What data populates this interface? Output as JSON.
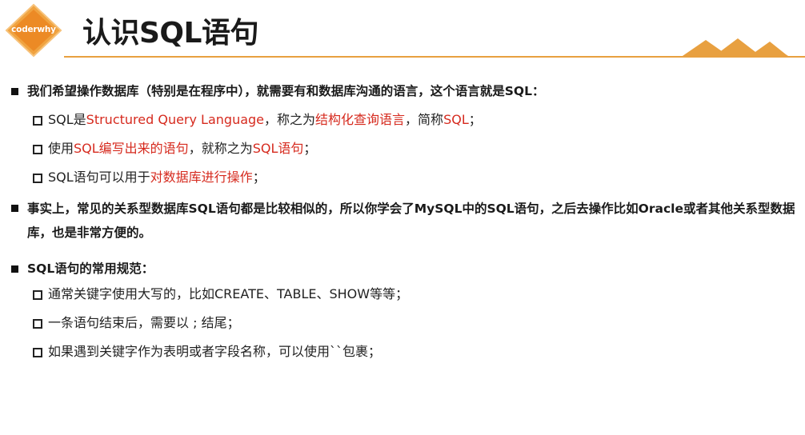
{
  "logo": {
    "text": "coderwhy",
    "bg_color": "#f0a340",
    "inner_color": "#ec8a25"
  },
  "title": "认识SQL语句",
  "accent_color": "#e8a040",
  "highlight_color": "#d62a1e",
  "sections": [
    {
      "text": "我们希望操作数据库（特别是在程序中），就需要有和数据库沟通的语言，这个语言就是SQL：",
      "items": [
        [
          {
            "t": "SQL是"
          },
          {
            "t": "Structured Query Language",
            "red": true
          },
          {
            "t": "，称之为"
          },
          {
            "t": "结构化查询语言",
            "red": true
          },
          {
            "t": "，简称"
          },
          {
            "t": "SQL",
            "red": true
          },
          {
            "t": "；"
          }
        ],
        [
          {
            "t": "使用"
          },
          {
            "t": "SQL编写出来的语句",
            "red": true
          },
          {
            "t": "，就称之为"
          },
          {
            "t": "SQL语句",
            "red": true
          },
          {
            "t": "；"
          }
        ],
        [
          {
            "t": "SQL语句可以用于"
          },
          {
            "t": "对数据库进行操作",
            "red": true
          },
          {
            "t": "；"
          }
        ]
      ]
    },
    {
      "text": "事实上，常见的关系型数据库SQL语句都是比较相似的，所以你学会了MySQL中的SQL语句，之后去操作比如Oracle或者其他关系型数据库，也是非常方便的。",
      "items": []
    },
    {
      "text": "SQL语句的常用规范：",
      "items": [
        [
          {
            "t": "通常关键字使用大写的，比如CREATE、TABLE、SHOW等等；"
          }
        ],
        [
          {
            "t": "一条语句结束后，需要以 ; 结尾；"
          }
        ],
        [
          {
            "t": "如果遇到关键字作为表明或者字段名称，可以使用``包裹；"
          }
        ]
      ]
    }
  ]
}
